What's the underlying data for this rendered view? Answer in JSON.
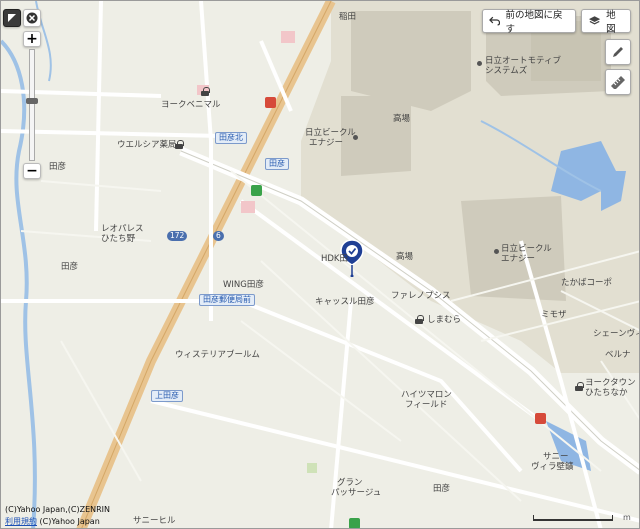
{
  "controls": {
    "back_button": "前の地図に戻す",
    "map_type_button": "地図",
    "zoom_in": "+",
    "zoom_out": "−"
  },
  "credits": {
    "copyright_line": "(C)Yahoo Japan,(C)ZENRIN",
    "terms_link": "利用規約",
    "copyright_yahoo": "(C)Yahoo Japan"
  },
  "scale": {
    "unit": "m"
  },
  "map": {
    "marker_label": "HDK田",
    "districts": {
      "umeda": "稲田",
      "takaba_1": "高場",
      "takaba_2": "高場",
      "tahiko_west": "田彦",
      "tahiko_mid": "田彦",
      "tahiko_south": "田彦"
    },
    "facilities": {
      "hitachi_auto": "日立オートモティブ",
      "hitachi_auto_2": "システムズ",
      "hitachi_building_1": "日立ビークル",
      "hitachi_building_1b": "エナジー",
      "hitachi_building_2": "日立ビークル",
      "hitachi_building_2b": "エナジー",
      "york_benimaru": "ヨークベニマル",
      "welcia": "ウエルシア薬局",
      "leopalace_1": "レオパレス",
      "leopalace_2": "ひたち野",
      "wing": "WING田彦",
      "post_office": "田彦郵便局前",
      "castle": "キャッスル田彦",
      "fareno": "ファレノプシス",
      "shimamura": "しまむら",
      "wisteria": "ウィステリアブールム",
      "haitsu_1": "ハイツマロン",
      "haitsu_2": "フィールド",
      "gran_1": "グラン",
      "gran_2": "パッサージュ",
      "sunny_hill": "サニーヒル",
      "takaba_court": "たかばコーポ",
      "mimoza": "ミモザ",
      "shane": "シェーンヴィ",
      "bellna": "ベルナ",
      "york_town_1": "ヨークタウン",
      "york_town_2": "ひたちなか",
      "sunny_villa_1": "サニー",
      "sunny_villa_2": "ヴィラ壁鑛"
    },
    "intersections": {
      "tahiko_kita": "田彦北",
      "tahiko": "田彦",
      "post_office_mae": "田彦郵便局前",
      "kamitahiko": "上田彦"
    },
    "route_numbers": {
      "r172": "172",
      "r6": "6"
    }
  }
}
